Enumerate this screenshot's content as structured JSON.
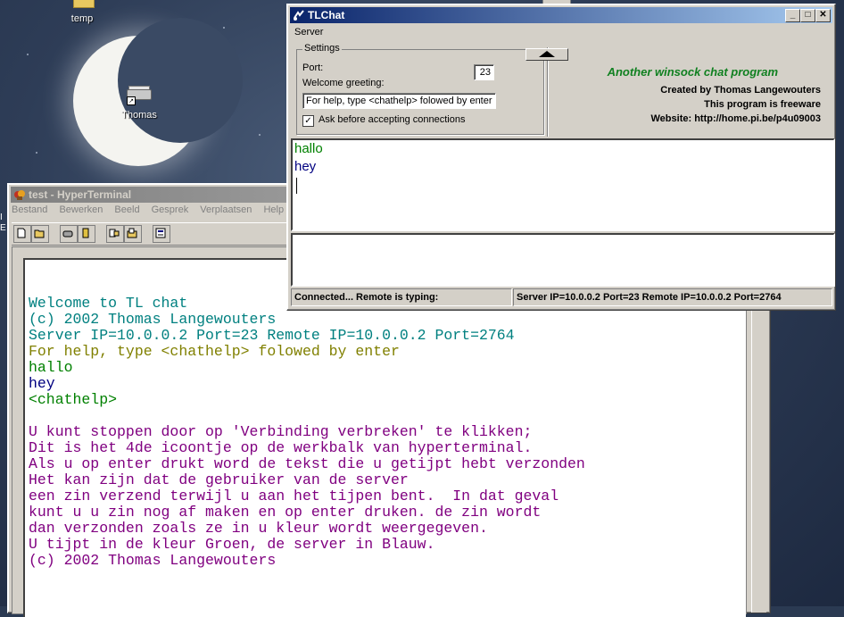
{
  "desktop": {
    "icons": [
      {
        "label": "temp",
        "icon": "folder-icon"
      },
      {
        "label": "Thomas",
        "icon": "network-drive-icon"
      }
    ],
    "edge_text": [
      "I",
      "E"
    ]
  },
  "hyperterminal": {
    "title": "test - HyperTerminal",
    "menu": [
      "Bestand",
      "Bewerken",
      "Beeld",
      "Gesprek",
      "Verplaatsen",
      "Help"
    ],
    "toolbar_icons": [
      "new-icon",
      "open-icon",
      "connect-icon",
      "disconnect-icon",
      "send-icon",
      "receive-icon",
      "properties-icon"
    ],
    "terminal_lines": [
      {
        "text": "Welcome to TL chat",
        "color": "#008080"
      },
      {
        "text": "(c) 2002 Thomas Langewouters",
        "color": "#008080"
      },
      {
        "text": "Server IP=10.0.0.2 Port=23 Remote IP=10.0.0.2 Port=2764",
        "color": "#008080"
      },
      {
        "text": "For help, type <chathelp> folowed by enter",
        "color": "#808000"
      },
      {
        "text": "hallo",
        "color": "#008000"
      },
      {
        "text": "hey",
        "color": "#000080"
      },
      {
        "text": "<chathelp>",
        "color": "#008000"
      },
      {
        "text": "",
        "color": "#000000"
      },
      {
        "text": "U kunt stoppen door op 'Verbinding verbreken' te klikken;",
        "color": "#800080"
      },
      {
        "text": "Dit is het 4de icoontje op de werkbalk van hyperterminal.",
        "color": "#800080"
      },
      {
        "text": "Als u op enter drukt word de tekst die u getijpt hebt verzonden",
        "color": "#800080"
      },
      {
        "text": "Het kan zijn dat de gebruiker van de server",
        "color": "#800080"
      },
      {
        "text": "een zin verzend terwijl u aan het tijpen bent.  In dat geval",
        "color": "#800080"
      },
      {
        "text": "kunt u u zin nog af maken en op enter druken. de zin wordt",
        "color": "#800080"
      },
      {
        "text": "dan verzonden zoals ze in u kleur wordt weergegeven.",
        "color": "#800080"
      },
      {
        "text": "U tijpt in de kleur Groen, de server in Blauw.",
        "color": "#800080"
      },
      {
        "text": "(c) 2002 Thomas Langewouters",
        "color": "#800080"
      }
    ]
  },
  "tlchat": {
    "title": "TLChat",
    "menu": [
      "Server"
    ],
    "settings": {
      "legend": "Settings",
      "port_label": "Port:",
      "port_value": "23",
      "greeting_label": "Welcome greeting:",
      "greeting_value": "For help, type <chathelp> folowed by enter",
      "ask_label": "Ask before accepting connections",
      "ask_checked": true
    },
    "about": {
      "tagline": "Another winsock chat program",
      "author": "Created by Thomas Langewouters",
      "license": "This program is freeware",
      "website": "Website:    http://home.pi.be/p4u09003"
    },
    "messages": [
      {
        "text": "hallo",
        "color": "#008000"
      },
      {
        "text": "hey",
        "color": "#000080"
      }
    ],
    "input_value": "",
    "status": {
      "left": "Connected...    Remote is typing:",
      "right": "Server IP=10.0.0.2 Port=23 Remote IP=10.0.0.2 Port=2764"
    }
  }
}
